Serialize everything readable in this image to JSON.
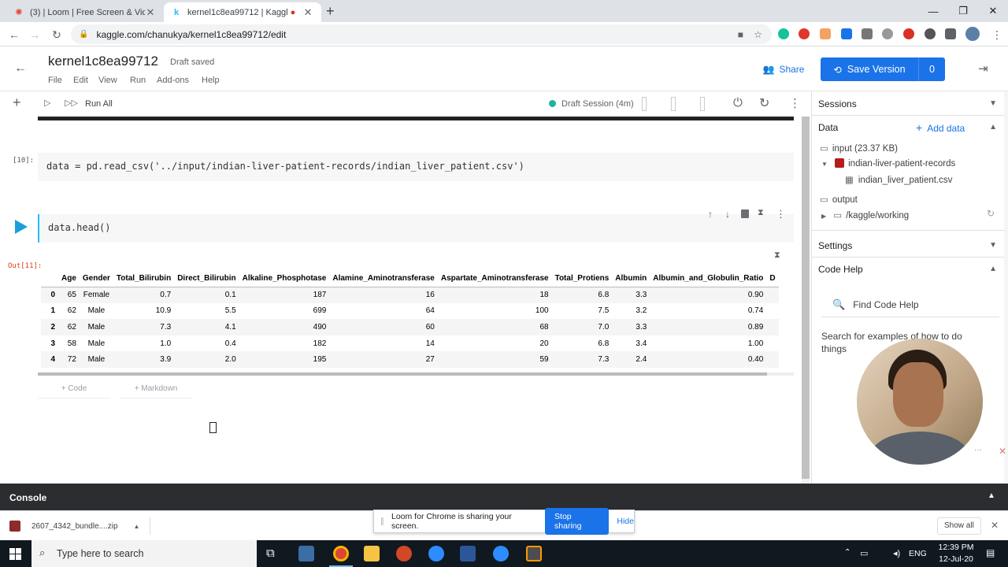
{
  "browser": {
    "tabs": [
      {
        "title": "(3) | Loom | Free Screen & Video",
        "favicon": "loom-icon"
      },
      {
        "title": "kernel1c8ea99712 | Kaggle",
        "favicon": "kaggle-icon"
      }
    ],
    "url": "kaggle.com/chanukya/kernel1c8ea99712/edit"
  },
  "kaggle": {
    "notebook_title": "kernel1c8ea99712",
    "save_status": "Draft saved",
    "menu": [
      "File",
      "Edit",
      "View",
      "Run",
      "Add-ons",
      "Help"
    ],
    "share_label": "Share",
    "save_version_label": "Save Version",
    "version_count": "0",
    "run_all_label": "Run All",
    "session_status": "Draft Session (4m)"
  },
  "cells": {
    "prompt_10": "[10]:",
    "code_10": "data = pd.read_csv('../input/indian-liver-patient-records/indian_liver_patient.csv')",
    "code_11": "data.head()",
    "out_prompt": "Out[11]:",
    "add_code": "+ Code",
    "add_markdown": "+ Markdown"
  },
  "dataframe": {
    "columns": [
      "",
      "Age",
      "Gender",
      "Total_Bilirubin",
      "Direct_Bilirubin",
      "Alkaline_Phosphotase",
      "Alamine_Aminotransferase",
      "Aspartate_Aminotransferase",
      "Total_Protiens",
      "Albumin",
      "Albumin_and_Globulin_Ratio",
      "D"
    ],
    "rows": [
      [
        "0",
        "65",
        "Female",
        "0.7",
        "0.1",
        "187",
        "16",
        "18",
        "6.8",
        "3.3",
        "0.90",
        ""
      ],
      [
        "1",
        "62",
        "Male",
        "10.9",
        "5.5",
        "699",
        "64",
        "100",
        "7.5",
        "3.2",
        "0.74",
        ""
      ],
      [
        "2",
        "62",
        "Male",
        "7.3",
        "4.1",
        "490",
        "60",
        "68",
        "7.0",
        "3.3",
        "0.89",
        ""
      ],
      [
        "3",
        "58",
        "Male",
        "1.0",
        "0.4",
        "182",
        "14",
        "20",
        "6.8",
        "3.4",
        "1.00",
        ""
      ],
      [
        "4",
        "72",
        "Male",
        "3.9",
        "2.0",
        "195",
        "27",
        "59",
        "7.3",
        "2.4",
        "0.40",
        ""
      ]
    ]
  },
  "panel": {
    "sessions": "Sessions",
    "data": "Data",
    "add_data": "Add data",
    "input": "input (23.37 KB)",
    "dataset": "indian-liver-patient-records",
    "file": "indian_liver_patient.csv",
    "output": "output",
    "working": "/kaggle/working",
    "settings": "Settings",
    "code_help": "Code Help",
    "find_placeholder": "Find Code Help",
    "help_text": "Search for examples of how to do things"
  },
  "console": {
    "label": "Console"
  },
  "downloads": {
    "file": "2607_4342_bundle....zip",
    "show_all": "Show all"
  },
  "loom": {
    "message": "Loom for Chrome is sharing your screen.",
    "stop": "Stop sharing",
    "hide": "Hide"
  },
  "taskbar": {
    "search_placeholder": "Type here to search",
    "lang": "ENG",
    "time": "12:39 PM",
    "date": "12-Jul-20"
  },
  "colors": {
    "accent": "#1a73e8",
    "kaggle_blue": "#008abc",
    "run_blue": "#20beff"
  }
}
